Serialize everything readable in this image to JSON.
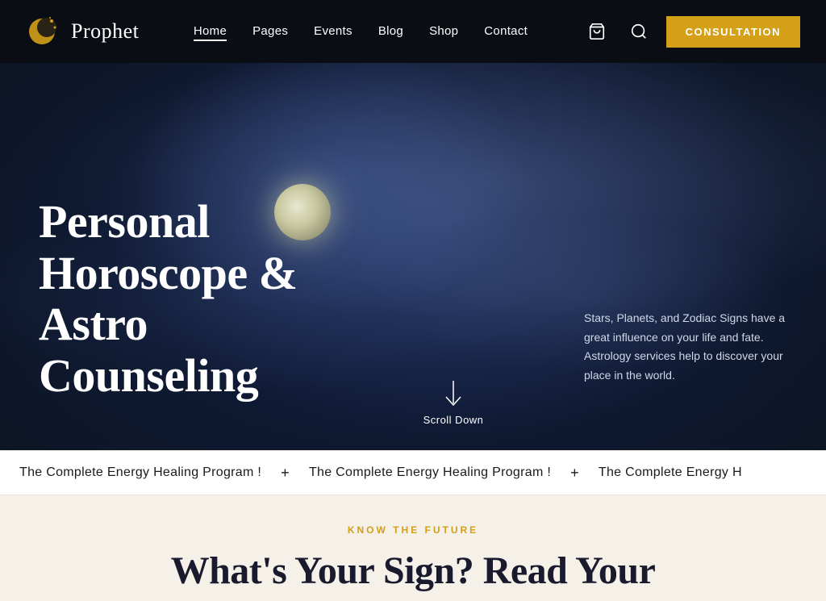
{
  "brand": {
    "name": "Prophet"
  },
  "navbar": {
    "links": [
      {
        "label": "Home",
        "active": true
      },
      {
        "label": "Pages",
        "active": false
      },
      {
        "label": "Events",
        "active": false
      },
      {
        "label": "Blog",
        "active": false
      },
      {
        "label": "Shop",
        "active": false
      },
      {
        "label": "Contact",
        "active": false
      }
    ],
    "consultation_label": "CONSULTATION"
  },
  "hero": {
    "title": "Personal Horoscope & Astro Counseling",
    "description": "Stars, Planets, and Zodiac Signs have a great influence on your life and fate. Astrology services help to discover your place in the world.",
    "scroll_label": "Scroll Down"
  },
  "ticker": {
    "items": [
      "The Complete Energy Healing Program !",
      "The Complete Energy Healing Program !",
      "The Complete Energy H"
    ]
  },
  "below_section": {
    "tag": "KNOW THE FUTURE",
    "title": "What's Your Sign? Read Your"
  }
}
